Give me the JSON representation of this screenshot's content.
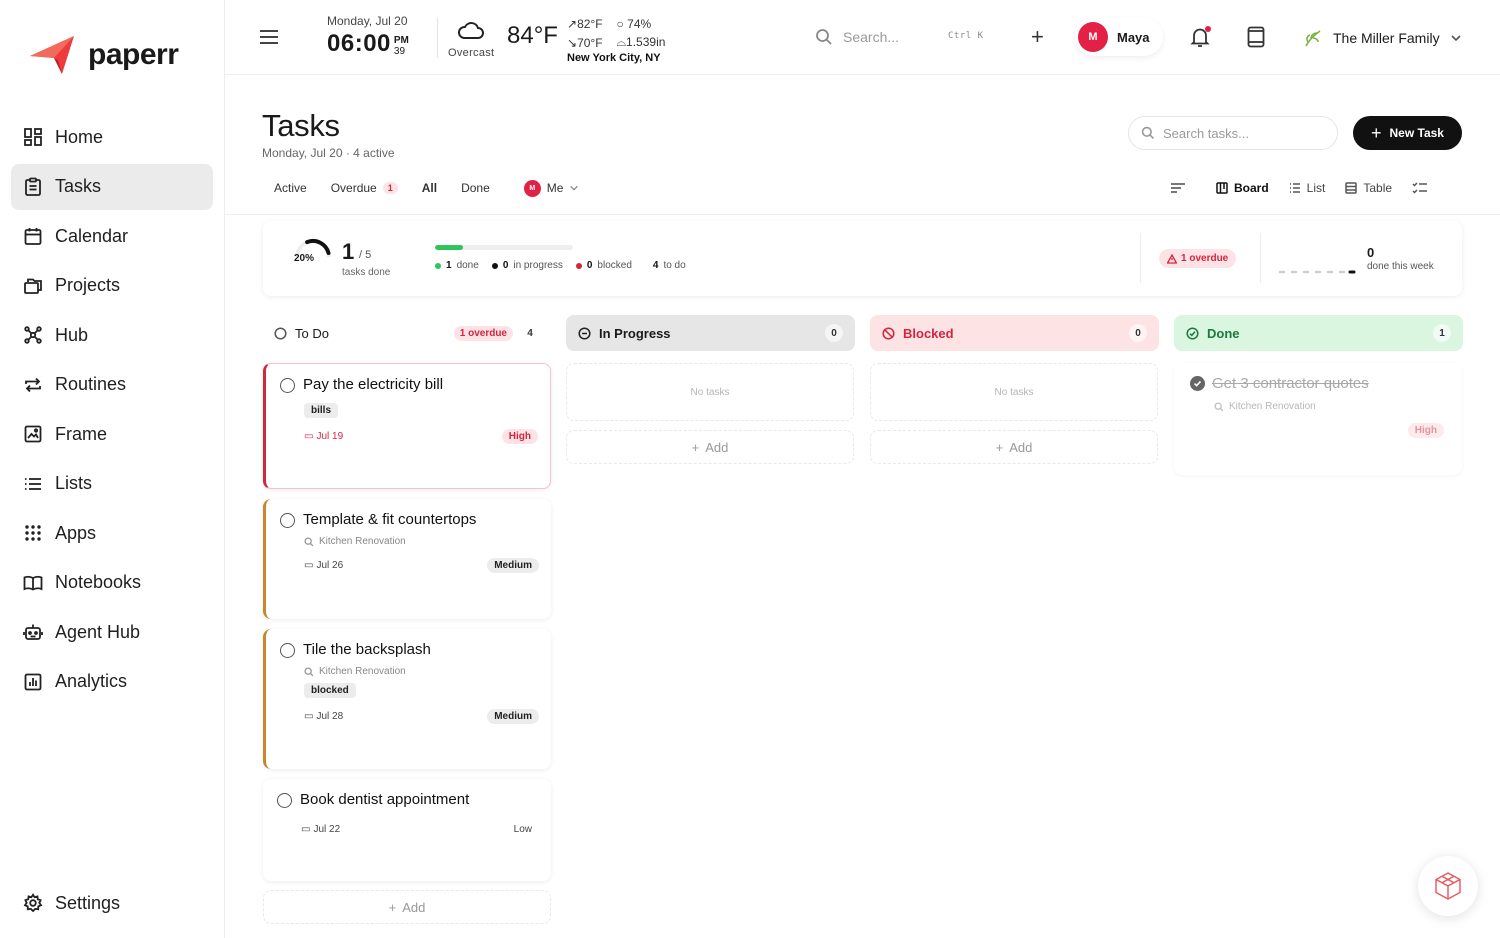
{
  "app": {
    "name": "paperr",
    "colors": {
      "accent": "#e32046",
      "done_green": "#2fc45c",
      "overdue_red": "#d4253e",
      "medium_border": "#c8862e"
    }
  },
  "sidebar": {
    "items": [
      {
        "label": "Home",
        "icon": "home-grid-icon",
        "active": false
      },
      {
        "label": "Tasks",
        "icon": "clipboard-icon",
        "active": true
      },
      {
        "label": "Calendar",
        "icon": "calendar-icon",
        "active": false
      },
      {
        "label": "Projects",
        "icon": "folders-icon",
        "active": false
      },
      {
        "label": "Hub",
        "icon": "hub-network-icon",
        "active": false
      },
      {
        "label": "Routines",
        "icon": "repeat-icon",
        "active": false
      },
      {
        "label": "Frame",
        "icon": "frame-icon",
        "active": false
      },
      {
        "label": "Lists",
        "icon": "list-icon",
        "active": false
      },
      {
        "label": "Apps",
        "icon": "apps-grid-icon",
        "active": false
      },
      {
        "label": "Notebooks",
        "icon": "book-icon",
        "active": false
      },
      {
        "label": "Agent Hub",
        "icon": "robot-icon",
        "active": false
      },
      {
        "label": "Analytics",
        "icon": "chart-icon",
        "active": false
      }
    ],
    "settings_label": "Settings"
  },
  "topbar": {
    "date": "Monday, Jul 20",
    "time": "06:00",
    "ampm": "PM",
    "seconds": "39",
    "weather": {
      "condition": "Overcast",
      "temp": "84°F",
      "high": "82°F",
      "low": "70°F",
      "humidity": "74%",
      "pressure": "1.539in",
      "location": "New York City, NY"
    },
    "search_placeholder": "Search...",
    "shortcut": "Ctrl K",
    "user": {
      "initial": "M",
      "name": "Maya"
    },
    "family": "The Miller Family"
  },
  "page": {
    "title": "Tasks",
    "subtitle": "Monday, Jul 20 · 4 active",
    "search_placeholder": "Search tasks...",
    "new_task_label": "New Task",
    "filters": [
      {
        "label": "Active",
        "active": false
      },
      {
        "label": "Overdue",
        "badge": "1",
        "active": false
      },
      {
        "label": "All",
        "active": true
      },
      {
        "label": "Done",
        "active": false
      }
    ],
    "assignee": {
      "initial": "M",
      "label": "Me"
    },
    "views": [
      {
        "label": "Board",
        "active": true
      },
      {
        "label": "List",
        "active": false
      },
      {
        "label": "Table",
        "active": false
      }
    ]
  },
  "summary": {
    "percent": "20%",
    "progress": 0.2,
    "done_count": "1",
    "done_total": "/ 5",
    "done_label": "tasks done",
    "legend": [
      {
        "value": "1",
        "label": "done",
        "color": "#2fc45c"
      },
      {
        "value": "0",
        "label": "in progress",
        "color": "#111111"
      },
      {
        "value": "0",
        "label": "blocked",
        "color": "#d4253e"
      },
      {
        "value": "4",
        "label": "to do",
        "color": ""
      }
    ],
    "overdue_label": "1 overdue",
    "week_count": "0",
    "week_label": "done this week"
  },
  "columns": {
    "todo": {
      "title": "To Do",
      "overdue": "1 overdue",
      "count": "4"
    },
    "in_progress": {
      "title": "In Progress",
      "count": "0",
      "empty": "No tasks"
    },
    "blocked": {
      "title": "Blocked",
      "count": "0",
      "empty": "No tasks"
    },
    "done": {
      "title": "Done",
      "count": "1"
    },
    "add_label": "Add"
  },
  "tasks": {
    "todo": [
      {
        "title": "Pay the electricity bill",
        "tag": "bills",
        "due": "Jul 19",
        "priority": "High"
      },
      {
        "title": "Template & fit countertops",
        "project": "Kitchen Renovation",
        "due": "Jul 26",
        "priority": "Medium"
      },
      {
        "title": "Tile the backsplash",
        "project": "Kitchen Renovation",
        "tag": "blocked",
        "due": "Jul 28",
        "priority": "Medium"
      },
      {
        "title": "Book dentist appointment",
        "due": "Jul 22",
        "priority": "Low"
      }
    ],
    "done": [
      {
        "title": "Get 3 contractor quotes",
        "project": "Kitchen Renovation",
        "priority": "High"
      }
    ]
  }
}
